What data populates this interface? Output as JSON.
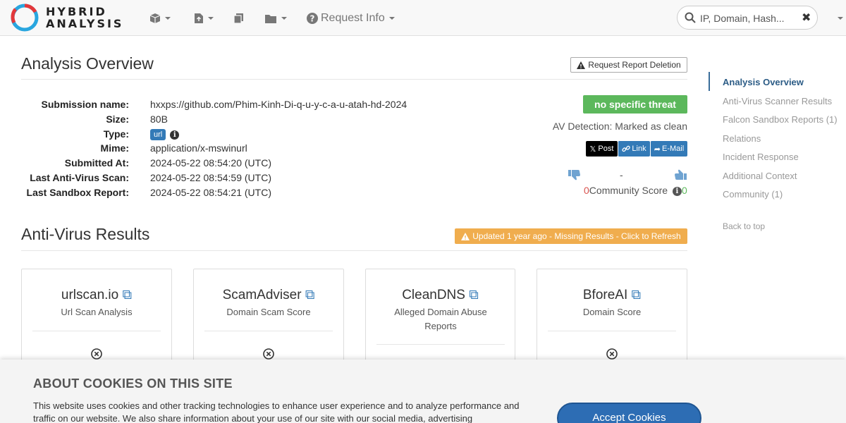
{
  "brand": {
    "line1": "HYBRID",
    "line2": "ANALYSIS"
  },
  "nav": {
    "request_info": "Request Info"
  },
  "search": {
    "placeholder": "IP, Domain, Hash..."
  },
  "overview": {
    "title": "Analysis Overview",
    "delete_button": "Request Report Deletion",
    "details": [
      {
        "label": "Submission name:",
        "value": "hxxps://github.com/Phim-Kinh-Di-q-u-y-c-a-u-atah-hd-2024"
      },
      {
        "label": "Size:",
        "value": "80B"
      },
      {
        "label": "Type:",
        "value": "url"
      },
      {
        "label": "Mime:",
        "value": "application/x-mswinurl"
      },
      {
        "label": "Submitted At:",
        "value": "2024-05-22 08:54:20 (UTC)"
      },
      {
        "label": "Last Anti-Virus Scan:",
        "value": "2024-05-22 08:54:59 (UTC)"
      },
      {
        "label": "Last Sandbox Report:",
        "value": "2024-05-22 08:54:21 (UTC)"
      }
    ],
    "threat_badge": "no specific threat",
    "av_detection": "AV Detection: Marked as clean",
    "share": {
      "post": "Post",
      "link": "Link",
      "email": "E-Mail"
    },
    "vote_dash": "-",
    "community": {
      "down_count": "0",
      "label": "Community Score",
      "up_count": "0"
    }
  },
  "antivirus": {
    "title": "Anti-Virus Results",
    "refresh_notice": "Updated 1 year ago - Missing Results - Click to Refresh",
    "cards": [
      {
        "name": "urlscan.io",
        "subtitle": "Url Scan Analysis"
      },
      {
        "name": "ScamAdviser",
        "subtitle": "Domain Scam Score"
      },
      {
        "name": "CleanDNS",
        "subtitle": "Alleged Domain Abuse Reports"
      },
      {
        "name": "BforeAI",
        "subtitle": "Domain Score"
      }
    ]
  },
  "sidebar": {
    "items": [
      {
        "label": "Analysis Overview"
      },
      {
        "label": "Anti-Virus Scanner Results"
      },
      {
        "label": "Falcon Sandbox Reports (1)"
      },
      {
        "label": "Relations"
      },
      {
        "label": "Incident Response"
      },
      {
        "label": "Additional Context"
      },
      {
        "label": "Community (1)"
      }
    ],
    "back_to_top": "Back to top"
  },
  "cookie": {
    "title": "ABOUT COOKIES ON THIS SITE",
    "text": "This website uses cookies and other tracking technologies to enhance user experience and to analyze performance and traffic on our website. We also share information about your use of our site with our social media, advertising",
    "accept": "Accept Cookies"
  },
  "colors": {
    "accent": "#337ab7",
    "success": "#5cb85c",
    "warning": "#f0ad4e",
    "danger": "#d9534f"
  }
}
